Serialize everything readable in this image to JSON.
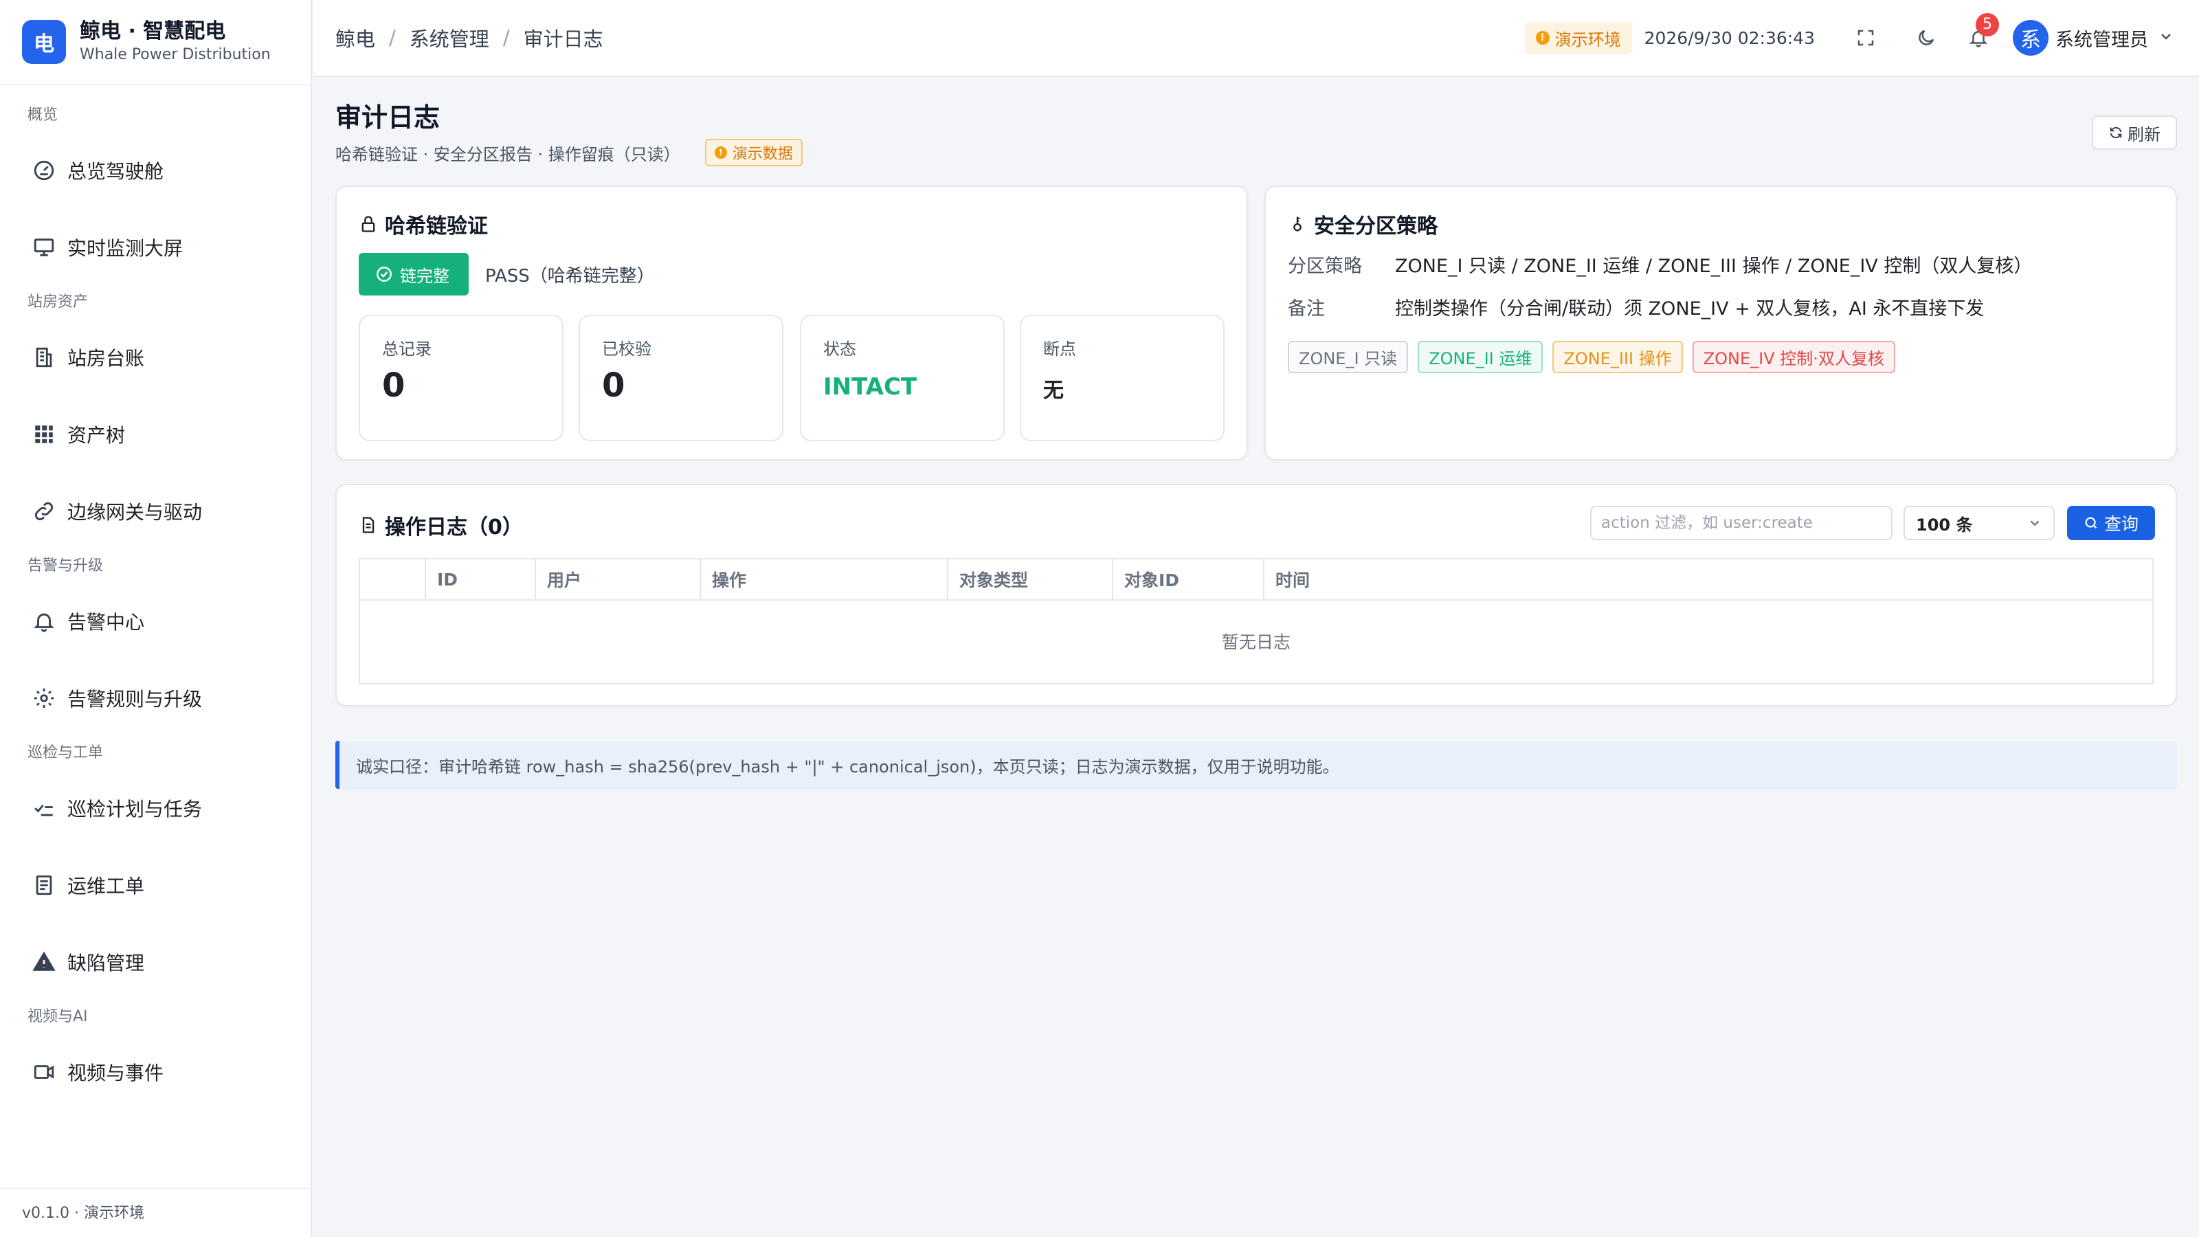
{
  "brand": {
    "logo_char": "电",
    "title": "鲸电 · 智慧配电",
    "subtitle": "Whale Power Distribution"
  },
  "sidebar": {
    "groups": [
      {
        "label": "概览",
        "items": [
          {
            "label": "总览驾驶舱",
            "icon": "gauge-icon"
          },
          {
            "label": "实时监测大屏",
            "icon": "monitor-icon"
          }
        ]
      },
      {
        "label": "站房资产",
        "items": [
          {
            "label": "站房台账",
            "icon": "building-icon"
          },
          {
            "label": "资产树",
            "icon": "grid-icon"
          },
          {
            "label": "边缘网关与驱动",
            "icon": "link-icon"
          }
        ]
      },
      {
        "label": "告警与升级",
        "items": [
          {
            "label": "告警中心",
            "icon": "bell-icon"
          },
          {
            "label": "告警规则与升级",
            "icon": "gear-icon"
          }
        ]
      },
      {
        "label": "巡检与工单",
        "items": [
          {
            "label": "巡检计划与任务",
            "icon": "checklist-icon"
          },
          {
            "label": "运维工单",
            "icon": "document-icon"
          },
          {
            "label": "缺陷管理",
            "icon": "warning-icon"
          }
        ]
      },
      {
        "label": "视频与AI",
        "items": [
          {
            "label": "视频与事件",
            "icon": "video-icon"
          }
        ]
      }
    ],
    "footer": "v0.1.0 · 演示环境"
  },
  "header": {
    "breadcrumb": [
      "鲸电",
      "系统管理",
      "审计日志"
    ],
    "env_badge": "演示环境",
    "datetime": "2026/9/30 02:36:43",
    "notification_count": "5",
    "avatar_char": "系",
    "user_name": "系统管理员"
  },
  "page": {
    "title": "审计日志",
    "subtitle": "哈希链验证 · 安全分区报告 · 操作留痕（只读）",
    "demo_tag": "演示数据",
    "refresh_label": "刷新"
  },
  "hash_card": {
    "title": "哈希链验证",
    "status_button": "链完整",
    "status_text": "PASS（哈希链完整）",
    "stats": [
      {
        "label": "总记录",
        "value": "0"
      },
      {
        "label": "已校验",
        "value": "0"
      },
      {
        "label": "状态",
        "value": "INTACT"
      },
      {
        "label": "断点",
        "value": "无"
      }
    ]
  },
  "zone_card": {
    "title": "安全分区策略",
    "policy_label": "分区策略",
    "policy_value": "ZONE_I 只读 / ZONE_II 运维 / ZONE_III 操作 / ZONE_IV 控制（双人复核）",
    "note_label": "备注",
    "note_value": "控制类操作（分合闸/联动）须 ZONE_IV + 双人复核，AI 永不直接下发",
    "tags": [
      {
        "label": "ZONE_I 只读",
        "color": "#6b7280"
      },
      {
        "label": "ZONE_II 运维",
        "color": "#16b07d"
      },
      {
        "label": "ZONE_III 操作",
        "color": "#e6911a"
      },
      {
        "label": "ZONE_IV 控制·双人复核",
        "color": "#e04848"
      }
    ]
  },
  "log_card": {
    "title": "操作日志（0）",
    "filter_placeholder": "action 过滤，如 user:create",
    "limit_value": "100 条",
    "query_label": "查询",
    "columns": [
      "ID",
      "用户",
      "操作",
      "对象类型",
      "对象ID",
      "时间"
    ],
    "empty_text": "暂无日志"
  },
  "notice": "诚实口径：审计哈希链 row_hash = sha256(prev_hash + \"|\" + canonical_json)，本页只读；日志为演示数据，仅用于说明功能。",
  "colors": {
    "primary": "#2463eb",
    "success": "#16b07d",
    "warning": "#d97706",
    "danger": "#e04848"
  }
}
